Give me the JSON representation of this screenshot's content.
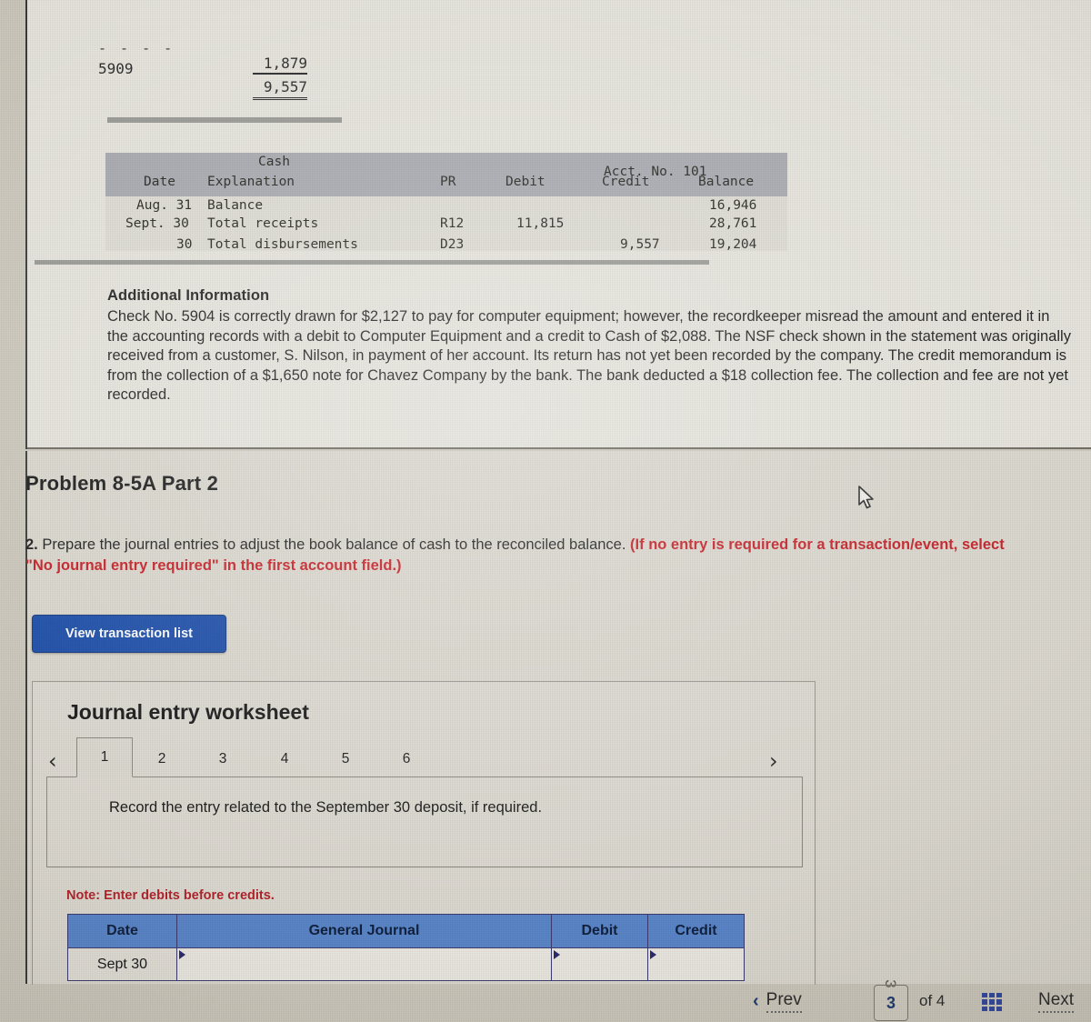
{
  "check_block": {
    "dashes": "- - - -",
    "check_number": "5909",
    "amount_1": "1,879",
    "amount_2": "9,557"
  },
  "ledger": {
    "title": "Cash",
    "acct_label": "Acct. No. 101",
    "headers": [
      "Date",
      "Explanation",
      "PR",
      "Debit",
      "Credit",
      "Balance"
    ],
    "rows": [
      {
        "date": "Aug. 31",
        "explanation": "Balance",
        "pr": "",
        "debit": "",
        "credit": "",
        "balance": "16,946"
      },
      {
        "date": "Sept. 30",
        "explanation": "Total receipts",
        "pr": "R12",
        "debit": "11,815",
        "credit": "",
        "balance": "28,761"
      },
      {
        "date": "30",
        "explanation": "Total disbursements",
        "pr": "D23",
        "debit": "",
        "credit": "9,557",
        "balance": "19,204"
      }
    ]
  },
  "additional_information": {
    "title": "Additional Information",
    "body": "Check No. 5904 is correctly drawn for $2,127 to pay for computer equipment; however, the recordkeeper misread the amount and entered it in the accounting records with a debit to Computer Equipment and a credit to Cash of $2,088. The NSF check shown in the statement was originally received from a customer, S. Nilson, in payment of her account. Its return has not yet been recorded by the company. The credit memorandum is from the collection of a $1,650 note for Chavez Company by the bank. The bank deducted a $18 collection fee. The collection and fee are not yet recorded."
  },
  "problem": {
    "title": "Problem 8-5A Part 2",
    "question_number": "2.",
    "question_text": " Prepare the journal entries to adjust the book balance of cash to the reconciled balance. ",
    "question_hint": "(If no entry is required for a transaction/event, select \"No journal entry required\" in the first account field.)"
  },
  "toolbar": {
    "view_transaction_list": "View transaction list"
  },
  "worksheet": {
    "title": "Journal entry worksheet",
    "prev_arrow": "‹",
    "next_arrow": "›",
    "tabs": [
      "1",
      "2",
      "3",
      "4",
      "5",
      "6"
    ],
    "active_tab": "1",
    "prompt": "Record the entry related to the September 30 deposit, if required.",
    "note": "Note: Enter debits before credits.",
    "table": {
      "headers": [
        "Date",
        "General Journal",
        "Debit",
        "Credit"
      ],
      "rows": [
        {
          "date": "Sept 30",
          "general_journal": "",
          "debit": "",
          "credit": ""
        }
      ]
    }
  },
  "navigation": {
    "prev_label": "Prev",
    "prev_icon": "‹",
    "page_value": "3",
    "page_ghost": "3",
    "of_label": "of 4",
    "grid_icon": "grid-icon",
    "next_label": "Next"
  },
  "colors": {
    "accent_blue": "#1d4ea8",
    "table_header_blue": "#5b86c8",
    "hint_red": "#c32027",
    "note_red": "#b0262c",
    "ledger_header_gray": "#a8aab0"
  }
}
